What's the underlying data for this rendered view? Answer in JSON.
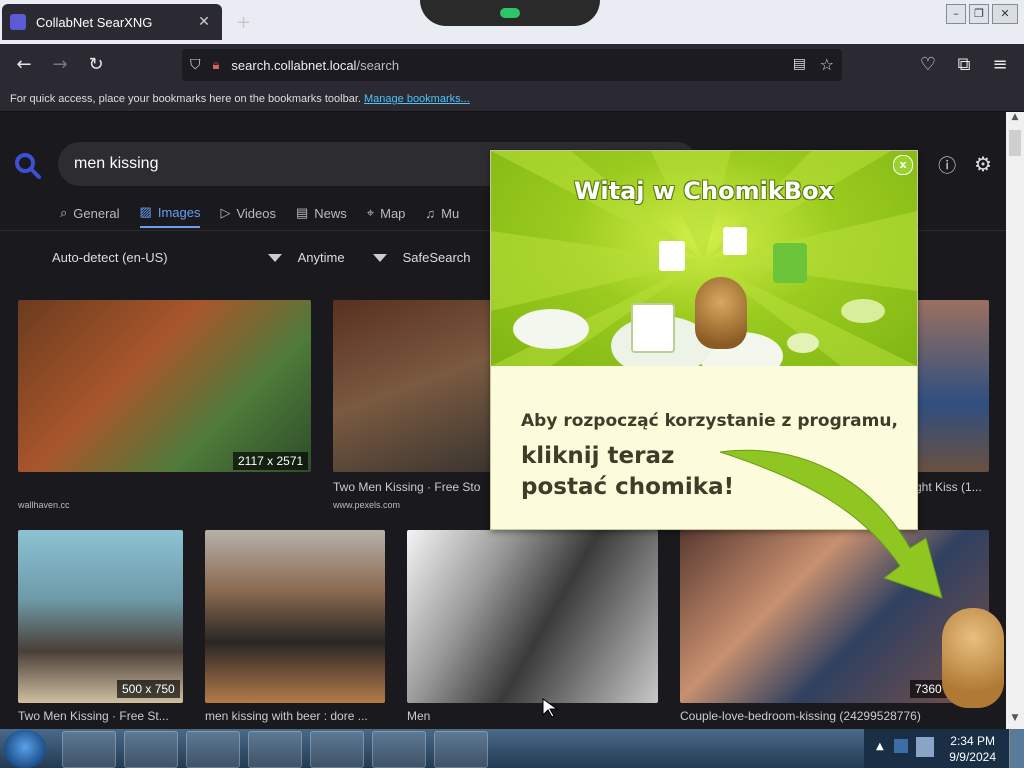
{
  "browser": {
    "tab_title": "CollabNet SearXNG",
    "url_host": "search.collabnet.local",
    "url_path": "/search",
    "bookmarks_text": "For quick access, place your bookmarks here on the bookmarks toolbar.",
    "bookmarks_link": "Manage bookmarks..."
  },
  "search": {
    "query": "men kissing",
    "tabs": [
      "General",
      "Images",
      "Videos",
      "News",
      "Map",
      "Mu"
    ],
    "active_tab": "Images",
    "filters": [
      "Auto-detect (en-US)",
      "Anytime",
      "SafeSearch"
    ]
  },
  "results": [
    {
      "caption": "",
      "source": "wallhaven.cc",
      "size": "2117 x 2571"
    },
    {
      "caption": "Two Men Kissing · Free Sto",
      "source": "www.pexels.com",
      "size": ""
    },
    {
      "caption": "ght Kiss (1...",
      "source": "",
      "size": ""
    },
    {
      "caption": "Two Men Kissing · Free St...",
      "source": "",
      "size": "500 x 750"
    },
    {
      "caption": "men kissing with beer : dore ...",
      "source": "",
      "size": ""
    },
    {
      "caption": "Men",
      "source": "",
      "size": ""
    },
    {
      "caption": "Couple-love-bedroom-kissing (24299528776)",
      "source": "",
      "size": "7360"
    }
  ],
  "popup": {
    "title": "Witaj w ChomikBox",
    "close": "x",
    "line1": "Aby rozpocząć korzystanie z programu,",
    "line2": "kliknij teraz",
    "line3": "postać chomika!"
  },
  "taskbar": {
    "time": "2:34 PM",
    "date": "9/9/2024"
  },
  "colors": {
    "accent": "#6a9ff2",
    "popup_green": "#9bcb1f",
    "link": "#4fc3f7"
  }
}
